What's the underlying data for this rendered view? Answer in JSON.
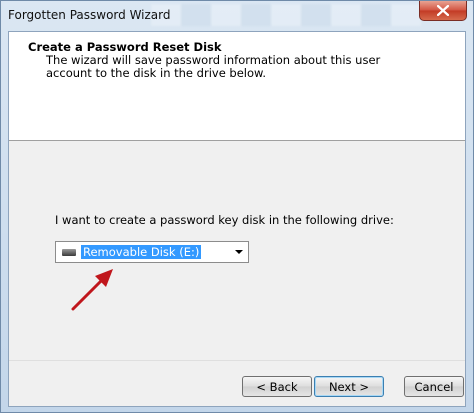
{
  "window": {
    "title": "Forgotten Password Wizard",
    "close_icon": "close-icon"
  },
  "header": {
    "title": "Create a Password Reset Disk",
    "description": "The wizard will save password information about this user account to the disk in the drive below."
  },
  "main": {
    "prompt": "I want to create a password key disk in the following drive:",
    "drive_select": {
      "selected_value": "Removable Disk (E:)",
      "icon": "drive-icon"
    },
    "annotation": {
      "icon": "red-arrow-icon",
      "color": "#c0161c"
    }
  },
  "footer": {
    "back_label": "< Back",
    "next_label": "Next >",
    "cancel_label": "Cancel"
  },
  "colors": {
    "selection": "#3399ff",
    "close_button": "#c23a25"
  }
}
